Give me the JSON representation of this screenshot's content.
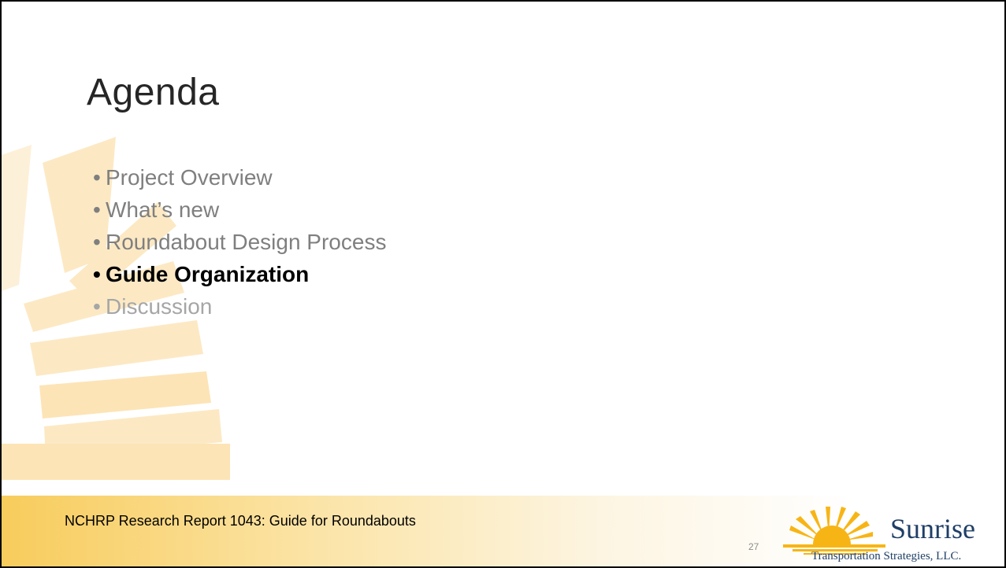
{
  "slide": {
    "title": "Agenda",
    "agenda_items": [
      {
        "bullet": "•",
        "label": "Project Overview"
      },
      {
        "bullet": "•",
        "label": "What’s new"
      },
      {
        "bullet": "•",
        "label": "Roundabout Design Process"
      },
      {
        "bullet": "•",
        "label": "Guide Organization"
      },
      {
        "bullet": "•",
        "label": "Discussion"
      }
    ],
    "footer_text": "NCHRP Research Report 1043: Guide for Roundabouts",
    "page_number": "27",
    "logo": {
      "name": "Sunrise",
      "tagline": "Transportation Strategies, LLC."
    }
  },
  "colors": {
    "title": "#262626",
    "item_normal": "#7f7f7f",
    "item_active": "#000000",
    "item_faded": "#a6a6a6",
    "sun_ray": "#fce9c4",
    "footer_band": "#f8cc5c",
    "logo_text": "#1f3f66",
    "logo_sun": "#f7b515"
  }
}
